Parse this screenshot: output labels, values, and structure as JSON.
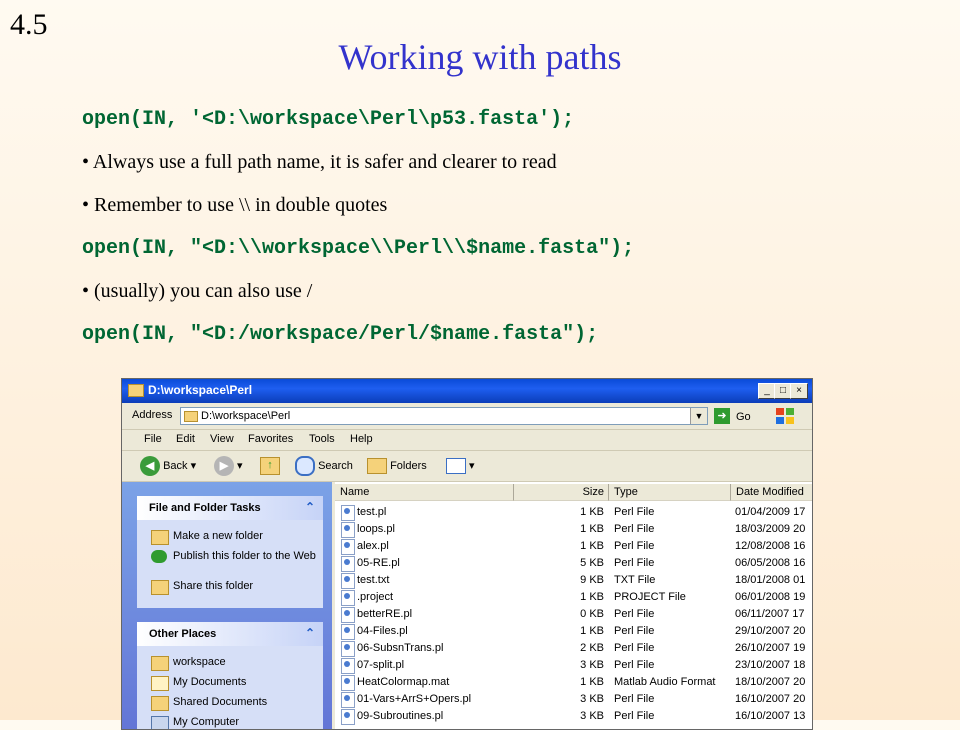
{
  "slide": {
    "number": "4.5",
    "title": "Working with paths",
    "code1": "open(IN, '<D:\\workspace\\Perl\\p53.fasta');",
    "bullet1": "• Always use a full path name, it is safer and clearer to read",
    "bullet2": "• Remember to use \\\\ in double quotes",
    "code2": "open(IN, \"<D:\\\\workspace\\\\Perl\\\\$name.fasta\");",
    "bullet3": "• (usually) you can also use /",
    "code3": "open(IN, \"<D:/workspace/Perl/$name.fasta\");"
  },
  "window": {
    "title": "D:\\workspace\\Perl",
    "address_label": "Address",
    "address_value": "D:\\workspace\\Perl",
    "go_label": "Go",
    "menu": [
      "File",
      "Edit",
      "View",
      "Favorites",
      "Tools",
      "Help"
    ],
    "toolbar": {
      "back": "Back",
      "search": "Search",
      "folders": "Folders"
    },
    "tasks_title": "File and Folder Tasks",
    "tasks": [
      "Make a new folder",
      "Publish this folder to the Web",
      "Share this folder"
    ],
    "places_title": "Other Places",
    "places": [
      "workspace",
      "My Documents",
      "Shared Documents",
      "My Computer"
    ],
    "columns": [
      "Name",
      "Size",
      "Type",
      "Date Modified"
    ],
    "files": [
      {
        "name": "test.pl",
        "size": "1 KB",
        "type": "Perl File",
        "date": "01/04/2009 17"
      },
      {
        "name": "loops.pl",
        "size": "1 KB",
        "type": "Perl File",
        "date": "18/03/2009 20"
      },
      {
        "name": "alex.pl",
        "size": "1 KB",
        "type": "Perl File",
        "date": "12/08/2008 16"
      },
      {
        "name": "05-RE.pl",
        "size": "5 KB",
        "type": "Perl File",
        "date": "06/05/2008 16"
      },
      {
        "name": "test.txt",
        "size": "9 KB",
        "type": "TXT File",
        "date": "18/01/2008 01"
      },
      {
        "name": ".project",
        "size": "1 KB",
        "type": "PROJECT File",
        "date": "06/01/2008 19"
      },
      {
        "name": "betterRE.pl",
        "size": "0 KB",
        "type": "Perl File",
        "date": "06/11/2007 17"
      },
      {
        "name": "04-Files.pl",
        "size": "1 KB",
        "type": "Perl File",
        "date": "29/10/2007 20"
      },
      {
        "name": "06-SubsnTrans.pl",
        "size": "2 KB",
        "type": "Perl File",
        "date": "26/10/2007 19"
      },
      {
        "name": "07-split.pl",
        "size": "3 KB",
        "type": "Perl File",
        "date": "23/10/2007 18"
      },
      {
        "name": "HeatColormap.mat",
        "size": "1 KB",
        "type": "Matlab Audio Format",
        "date": "18/10/2007 20"
      },
      {
        "name": "01-Vars+ArrS+Opers.pl",
        "size": "3 KB",
        "type": "Perl File",
        "date": "16/10/2007 20"
      },
      {
        "name": "09-Subroutines.pl",
        "size": "3 KB",
        "type": "Perl File",
        "date": "16/10/2007 13"
      }
    ]
  }
}
